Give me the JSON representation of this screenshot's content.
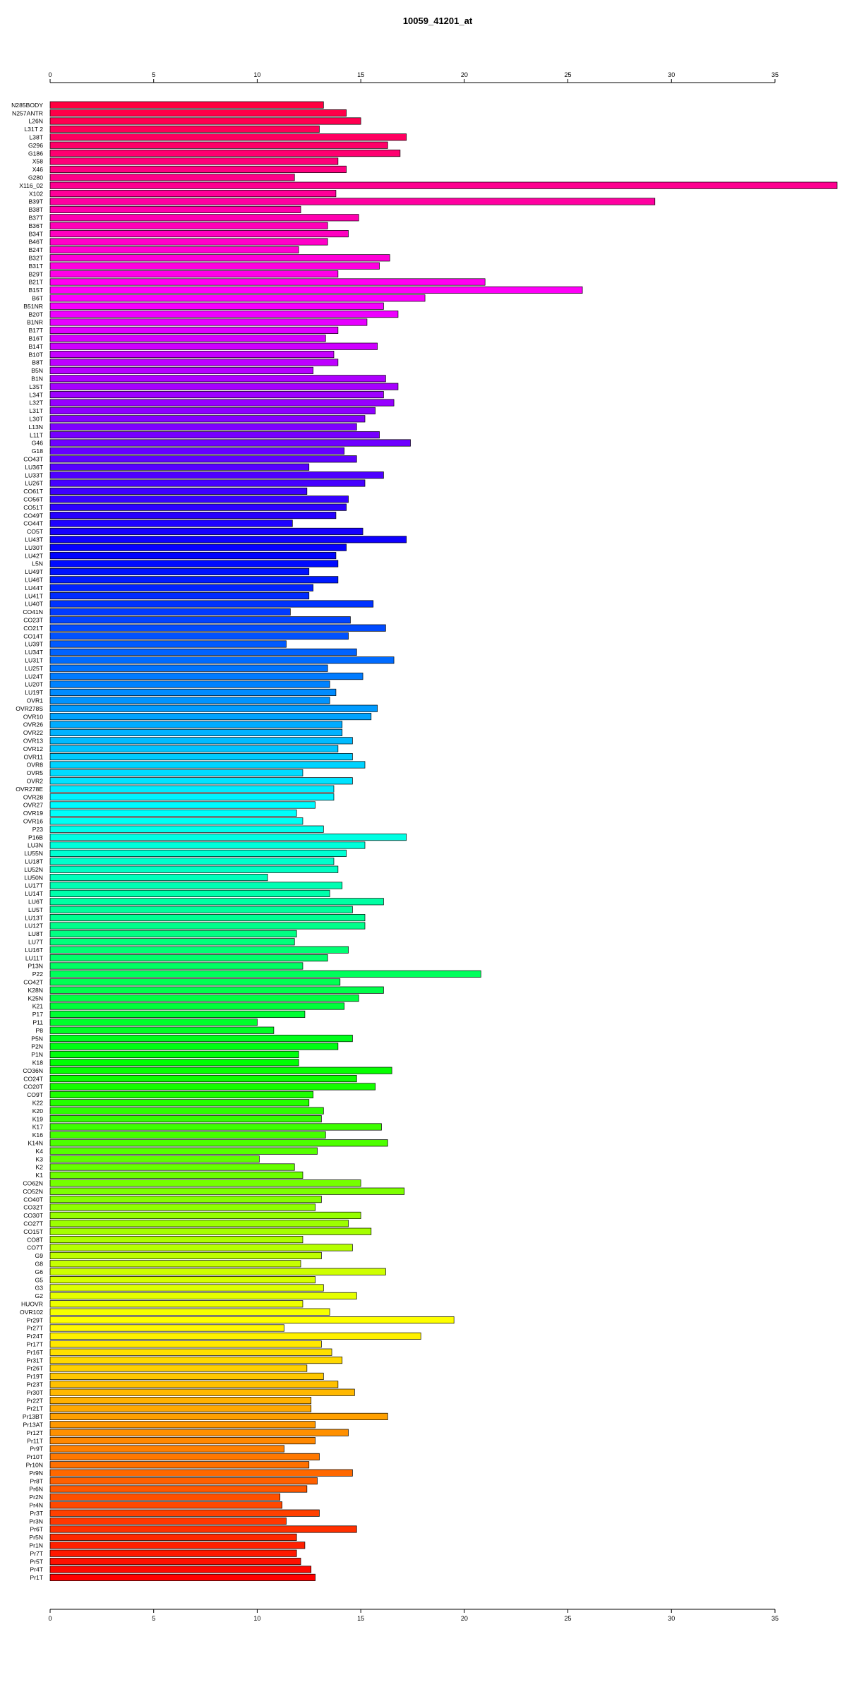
{
  "chart_data": {
    "type": "bar",
    "orientation": "horizontal",
    "title": "10059_41201_at",
    "xlabel": "",
    "ylabel": "",
    "xlim": [
      0,
      38
    ],
    "x_ticks": [
      0,
      5,
      10,
      15,
      20,
      25,
      30,
      35
    ],
    "x_tick_labels": [
      "0",
      "5",
      "10",
      "15",
      "20",
      "25",
      "30",
      "35"
    ],
    "grid": false,
    "legend": "none",
    "colors": "rainbow gradient from red through magenta, purple, blue, cyan, green, yellow, orange back to red",
    "categories": [
      "N285BODY",
      "N257ANTR",
      "L26N",
      "L31T 2",
      "L38T",
      "G296",
      "G186",
      "X58",
      "X46",
      "G280",
      "X116_02",
      "X102",
      "B39T",
      "B38T",
      "B37T",
      "B36T",
      "B34T",
      "B46T",
      "B24T",
      "B32T",
      "B31T",
      "B29T",
      "B21T",
      "B15T",
      "B6T",
      "B51NR",
      "B20T",
      "B1NR",
      "B17T",
      "B16T",
      "B14T",
      "B10T",
      "B8T",
      "B5N",
      "B1N",
      "L35T",
      "L34T",
      "L32T",
      "L31T",
      "L30T",
      "L13N",
      "L11T",
      "G46",
      "G18",
      "CO43T",
      "LU36T",
      "LU33T",
      "LU26T",
      "CO61T",
      "CO56T",
      "CO51T",
      "CO49T",
      "CO44T",
      "CO5T",
      "LU43T",
      "LU30T",
      "LU42T",
      "L5N",
      "LU49T",
      "LU46T",
      "LU44T",
      "LU41T",
      "LU40T",
      "CO41N",
      "CO23T",
      "CO21T",
      "CO14T",
      "LU39T",
      "LU34T",
      "LU31T",
      "LU25T",
      "LU24T",
      "LU20T",
      "LU19T",
      "OVR1",
      "OVR278S",
      "OVR10",
      "OVR26",
      "OVR22",
      "OVR13",
      "OVR12",
      "OVR11",
      "OVR8",
      "OVR5",
      "OVR2",
      "OVR278E",
      "OVR28",
      "OVR27",
      "OVR19",
      "OVR16",
      "P23",
      "P16B",
      "LU3N",
      "LU55N",
      "LU18T",
      "LU52N",
      "LU50N",
      "LU17T",
      "LU14T",
      "LU6T",
      "LU5T",
      "LU13T",
      "LU12T",
      "LU8T",
      "LU7T",
      "LU16T",
      "LU11T",
      "P13N",
      "P22",
      "CO42T",
      "K28N",
      "K25N",
      "K21",
      "P17",
      "P11",
      "P8",
      "P5N",
      "P2N",
      "P1N",
      "K18",
      "CO36N",
      "CO24T",
      "CO20T",
      "CO9T",
      "K22",
      "K20",
      "K19",
      "K17",
      "K16",
      "K14N",
      "K4",
      "K3",
      "K2",
      "K1",
      "CO62N",
      "CO52N",
      "CO40T",
      "CO32T",
      "CO30T",
      "CO27T",
      "CO15T",
      "CO8T",
      "CO7T",
      "G9",
      "G8",
      "G6",
      "G5",
      "G3",
      "G2",
      "HUOVR",
      "OVR102",
      "Pr29T",
      "Pr27T",
      "Pr24T",
      "Pr17T",
      "Pr16T",
      "Pr31T",
      "Pr26T",
      "Pr19T",
      "Pr23T",
      "Pr30T",
      "Pr22T",
      "Pr21T",
      "Pr13BT",
      "Pr13AT",
      "Pr12T",
      "Pr11T",
      "Pr9T",
      "Pr10T",
      "Pr10N",
      "Pr9N",
      "Pr8T",
      "Pr6N",
      "Pr2N",
      "Pr4N",
      "Pr3T",
      "Pr3N",
      "Pr6T",
      "Pr5N",
      "Pr1N",
      "Pr7T",
      "Pr5T",
      "Pr4T",
      "Pr1T"
    ],
    "values": [
      13.2,
      14.3,
      15.0,
      13.0,
      17.2,
      16.3,
      16.9,
      13.9,
      14.3,
      11.8,
      38.0,
      13.8,
      29.2,
      12.1,
      14.9,
      13.4,
      14.4,
      13.4,
      12.0,
      16.4,
      15.9,
      13.9,
      21.0,
      25.7,
      18.1,
      16.1,
      16.8,
      15.3,
      13.9,
      13.3,
      15.8,
      13.7,
      13.9,
      12.7,
      16.2,
      16.8,
      16.1,
      16.6,
      15.7,
      15.2,
      14.8,
      15.9,
      17.4,
      14.2,
      14.8,
      12.5,
      16.1,
      15.2,
      12.4,
      14.4,
      14.3,
      13.8,
      11.7,
      15.1,
      17.2,
      14.3,
      13.8,
      13.9,
      12.5,
      13.9,
      12.7,
      12.5,
      15.6,
      11.6,
      14.5,
      16.2,
      14.4,
      11.4,
      14.8,
      16.6,
      13.4,
      15.1,
      13.5,
      13.8,
      13.5,
      15.8,
      15.5,
      14.1,
      14.1,
      14.6,
      13.9,
      14.6,
      15.2,
      12.2,
      14.6,
      13.7,
      13.7,
      12.8,
      11.9,
      12.2,
      13.2,
      17.2,
      15.2,
      14.3,
      13.7,
      13.9,
      10.5,
      14.1,
      13.5,
      16.1,
      14.6,
      15.2,
      15.2,
      11.9,
      11.8,
      14.4,
      13.4,
      12.2,
      20.8,
      14.0,
      16.1,
      14.9,
      14.2,
      12.3,
      10.0,
      10.8,
      14.6,
      13.9,
      12.0,
      12.0,
      16.5,
      14.8,
      15.7,
      12.7,
      12.5,
      13.2,
      13.1,
      16.0,
      13.3,
      16.3,
      12.9,
      10.1,
      11.8,
      12.2,
      15.0,
      17.1,
      13.1,
      12.8,
      15.0,
      14.4,
      15.5,
      12.2,
      14.6,
      13.1,
      12.1,
      16.2,
      12.8,
      13.2,
      14.8,
      12.2,
      13.5,
      19.5,
      11.3,
      17.9,
      13.1,
      13.6,
      14.1,
      12.4,
      13.2,
      13.9,
      14.7,
      12.6,
      12.6,
      16.3,
      12.8,
      14.4,
      12.8,
      11.3,
      13.0,
      12.5,
      14.6,
      12.9,
      12.4,
      11.1,
      11.2,
      13.0,
      11.4,
      14.8,
      11.9,
      12.3,
      11.9,
      12.1,
      12.6,
      12.8
    ]
  }
}
